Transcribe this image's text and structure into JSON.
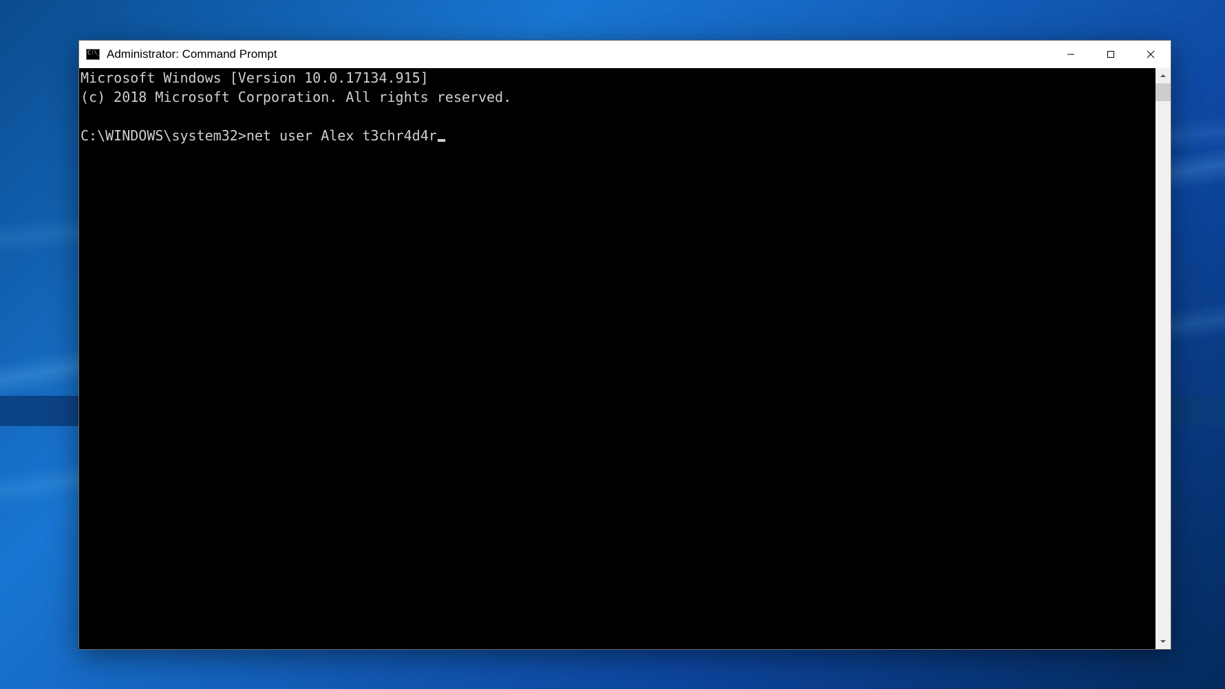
{
  "window": {
    "title": "Administrator: Command Prompt"
  },
  "terminal": {
    "line1": "Microsoft Windows [Version 10.0.17134.915]",
    "line2": "(c) 2018 Microsoft Corporation. All rights reserved.",
    "blank": "",
    "prompt": "C:\\WINDOWS\\system32>",
    "command": "net user Alex t3chr4d4r"
  }
}
